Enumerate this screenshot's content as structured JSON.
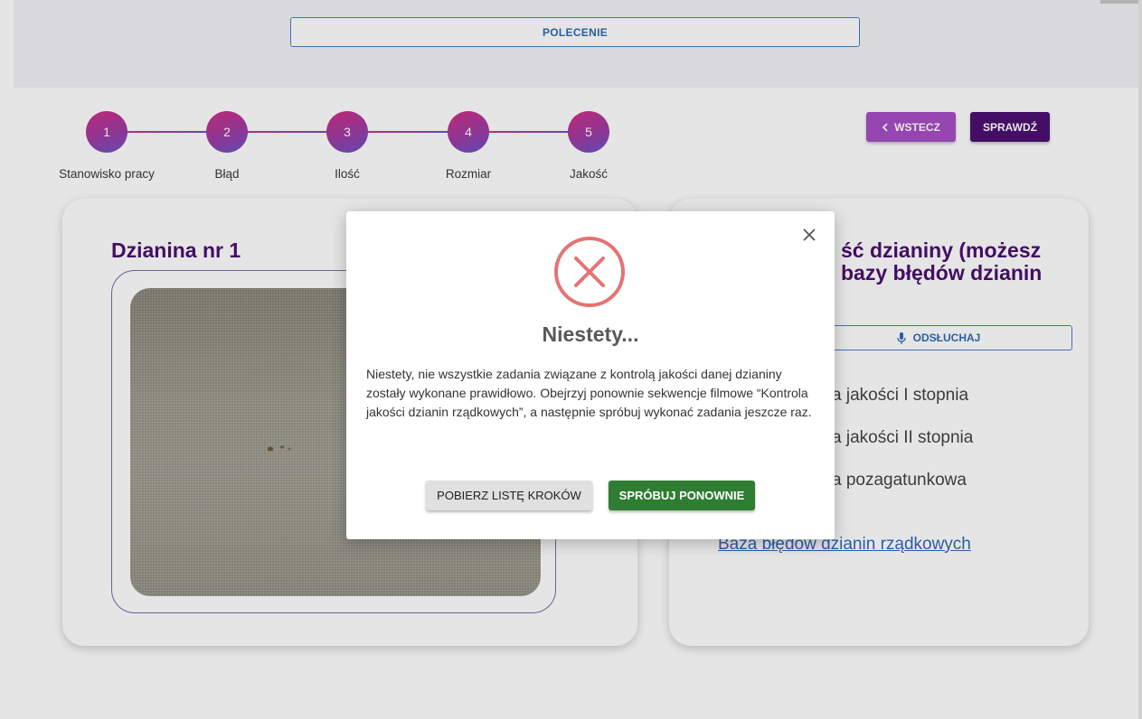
{
  "header": {
    "polecenie_label": "POLECENIE"
  },
  "stepper": {
    "steps": [
      {
        "number": "1",
        "label": "Stanowisko pracy"
      },
      {
        "number": "2",
        "label": "Błąd"
      },
      {
        "number": "3",
        "label": "Ilość"
      },
      {
        "number": "4",
        "label": "Rozmiar"
      },
      {
        "number": "5",
        "label": "Jakość"
      }
    ]
  },
  "nav": {
    "back_label": "WSTECZ",
    "check_label": "SPRAWDŹ"
  },
  "left_card": {
    "title": "Dzianina nr 1"
  },
  "right_card": {
    "title_line1": "ść dzianiny (możesz",
    "title_line2": "bazy błędów dzianin",
    "title_line3": "):",
    "listen_label": "ODSŁUCHAJ",
    "options": [
      "a jakości I stopnia",
      "a jakości II stopnia",
      "a pozagatunkowa"
    ],
    "database_link": "Baza błędów dzianin rządkowych"
  },
  "modal": {
    "title": "Niestety...",
    "message": "Niestety, nie wszystkie zadania związane z kontrolą jakości danej dzianiny zostały wykonane prawidłowo. Obejrzyj ponownie sekwencje filmowe “Kontrola jakości dzianin rządkowych”, a następnie spróbuj wykonać zadania jeszcze raz.",
    "download_label": "POBIERZ LISTĘ KROKÓW",
    "retry_label": "SPRÓBUJ PONOWNIE"
  },
  "colors": {
    "brand_purple": "#4b1070",
    "back_button": "#a64fc4",
    "link_blue": "#2f6ab5",
    "error_red": "#e57373",
    "retry_green": "#2e7d32"
  }
}
